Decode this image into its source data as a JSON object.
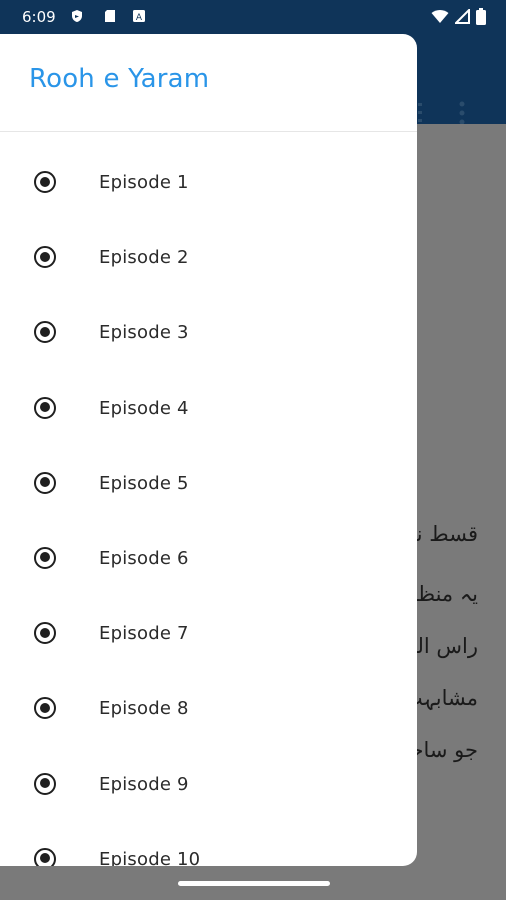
{
  "status_bar": {
    "time": "6:09",
    "left_icons": [
      "shield-icon",
      "sd-card-icon",
      "translate-icon"
    ],
    "right_icons": [
      "wifi-icon",
      "signal-icon",
      "battery-icon"
    ]
  },
  "drawer": {
    "title": "Rooh e Yaram",
    "episodes": [
      {
        "label": "Episode 1"
      },
      {
        "label": "Episode 2"
      },
      {
        "label": "Episode 3"
      },
      {
        "label": "Episode 4"
      },
      {
        "label": "Episode 5"
      },
      {
        "label": "Episode 6"
      },
      {
        "label": "Episode 7"
      },
      {
        "label": "Episode 8"
      },
      {
        "label": "Episode 9"
      },
      {
        "label": "Episode 10"
      }
    ]
  },
  "background_content": {
    "lines": [
      "قسط نمبر",
      "یہ منظر د",
      "راس الخیم",
      "مشابہت",
      "جو ساحل"
    ]
  },
  "colors": {
    "app_bar": "#0f3459",
    "title": "#2a95e8",
    "scrim": "#7a7a7a"
  }
}
